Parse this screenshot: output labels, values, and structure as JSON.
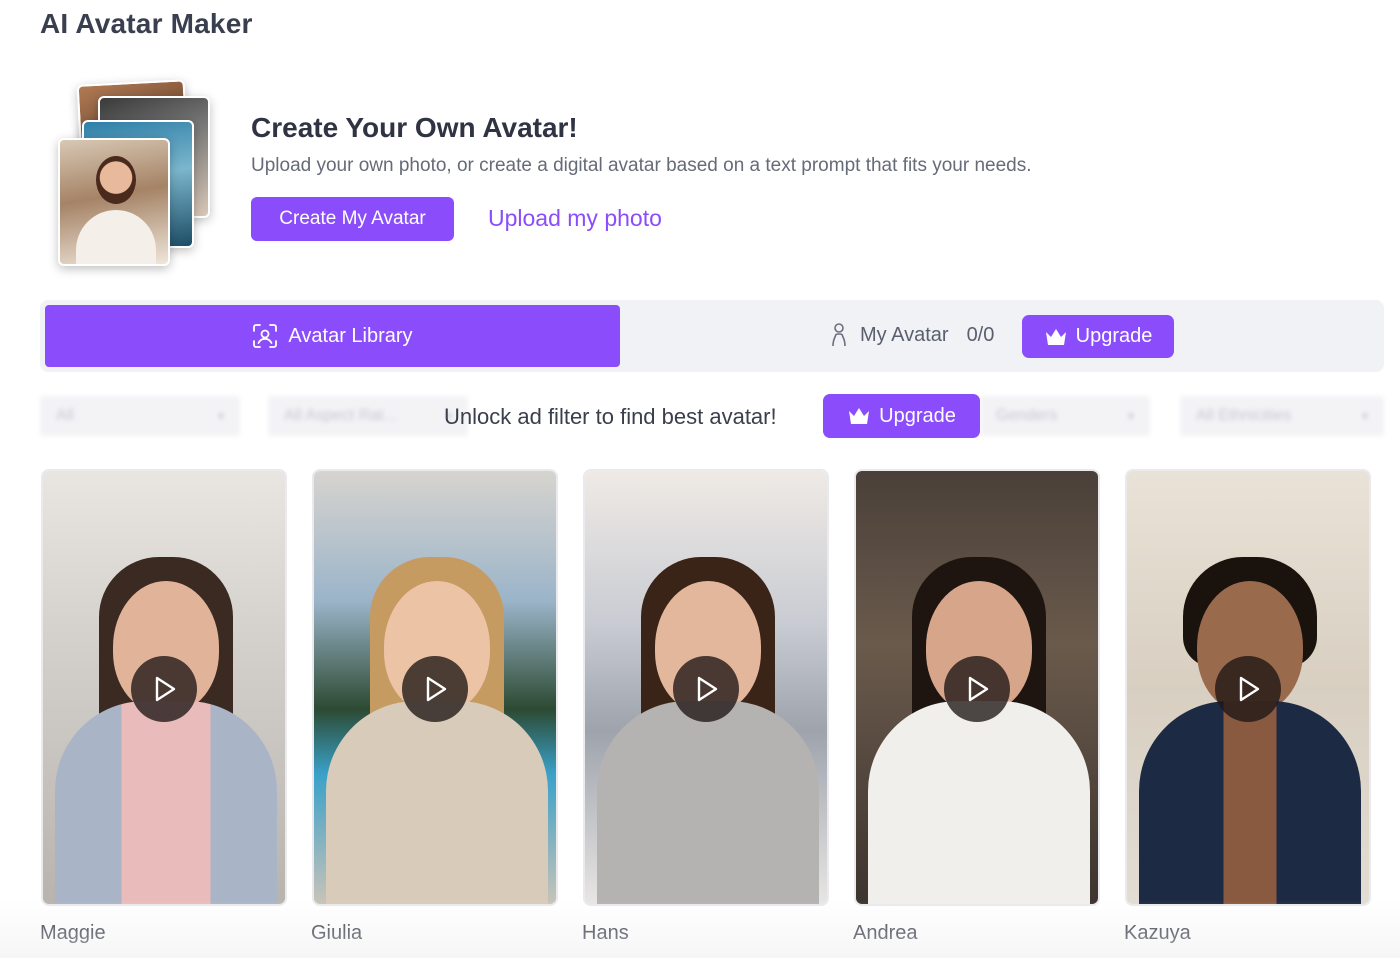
{
  "header": {
    "title": "AI Avatar Maker"
  },
  "hero": {
    "heading": "Create Your Own Avatar!",
    "description": "Upload your own photo, or create a digital avatar based on a text prompt that fits your needs.",
    "create_button": "Create My Avatar",
    "upload_link": "Upload my photo"
  },
  "tabs": {
    "library_label": "Avatar Library",
    "library_icon": "face-scan-icon",
    "my_avatar_label": "My Avatar",
    "my_avatar_icon": "person-outline-icon",
    "my_avatar_count": "0/0",
    "upgrade_label": "Upgrade",
    "upgrade_icon": "crown-icon"
  },
  "filters": {
    "unlock_text": "Unlock ad filter to find best avatar!",
    "upgrade_label": "Upgrade",
    "selects": [
      {
        "label": "All"
      },
      {
        "label": "All Aspect Rat..."
      },
      {
        "label": "Genders"
      },
      {
        "label": "All Ethnicities"
      }
    ]
  },
  "avatars": [
    {
      "name": "Maggie"
    },
    {
      "name": "Giulia"
    },
    {
      "name": "Hans"
    },
    {
      "name": "Andrea"
    },
    {
      "name": "Kazuya"
    }
  ],
  "colors": {
    "accent": "#8b4dfb",
    "tab_bar_bg": "#f1f2f6",
    "title": "#3a3f4f"
  }
}
